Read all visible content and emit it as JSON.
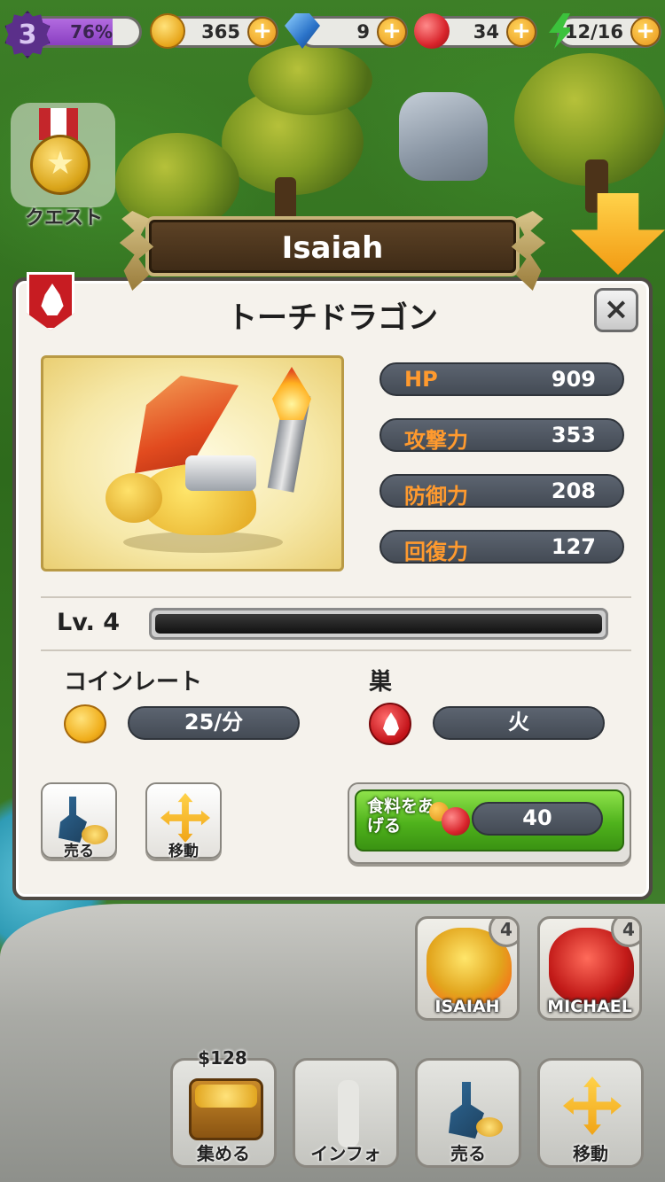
{
  "hud": {
    "level": "3",
    "xp_percent": "76%",
    "xp_fraction": 0.76,
    "coins": "365",
    "gems": "9",
    "food": "34",
    "energy": "12/16",
    "plus": "+"
  },
  "quest": {
    "label": "クエスト"
  },
  "dragon": {
    "name": "Isaiah",
    "species": "トーチドラゴン",
    "element_icon": "fire-icon",
    "stats": [
      {
        "label": "HP",
        "value": "909"
      },
      {
        "label": "攻撃力",
        "value": "353"
      },
      {
        "label": "防御力",
        "value": "208"
      },
      {
        "label": "回復力",
        "value": "127"
      }
    ],
    "level_label": "Lv. 4",
    "level_progress": 0.0,
    "coin_rate_label": "コインレート",
    "coin_rate_value": "25/分",
    "nest_label": "巣",
    "nest_value": "火"
  },
  "panel_buttons": {
    "close": "×",
    "sell": "売る",
    "move": "移動",
    "feed_label": "食料をあげる",
    "feed_cost": "40"
  },
  "dragon_cards": [
    {
      "name": "ISAIAH",
      "level": "4"
    },
    {
      "name": "MICHAEL",
      "level": "4"
    }
  ],
  "bottom_bar": {
    "money": "$128",
    "collect": "集める",
    "info": "インフォ",
    "sell": "売る",
    "move": "移動"
  },
  "colors": {
    "stat_key": "#ff9a2e",
    "feed_green": "#4fb21c",
    "fire_red": "#c71c22",
    "xp_purple": "#8a3fc2"
  }
}
